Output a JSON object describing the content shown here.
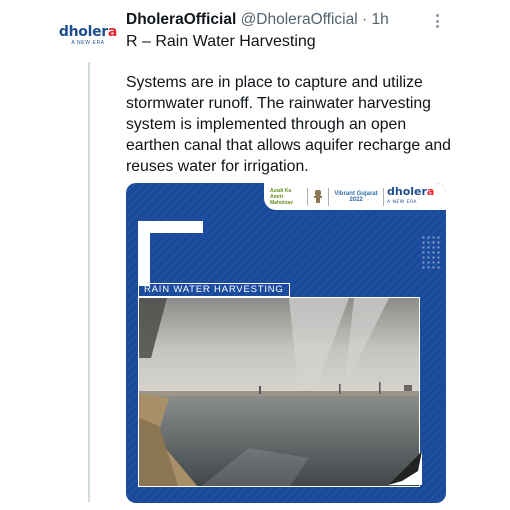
{
  "tweet": {
    "author_name": "DholeraOfficial",
    "handle": "@DholeraOfficial",
    "separator": "·",
    "time": "1h",
    "subtitle": "R – Rain Water Harvesting",
    "text": "Systems are in place to capture and utilize stormwater runoff. The rainwater harvesting system is implemented through an open earthen canal that allows aquifer recharge and reuses water for irrigation."
  },
  "avatar": {
    "brand_main": "dholer",
    "brand_dot": "a",
    "tagline": "A NEW ERA"
  },
  "card": {
    "label": "RAIN WATER HARVESTING",
    "brand_main": "dholer",
    "brand_dot": "a",
    "brand_tagline": "A NEW ERA",
    "logo_left": "Azadi Ka Amrit Mahotsav",
    "logo_middle": "Vibrant Gujarat 2022"
  },
  "colors": {
    "card_blue": "#1a4a9c",
    "brand_blue": "#1d4f91",
    "brand_red": "#e8212d",
    "muted": "#536471"
  },
  "icons": [
    "more-options-icon",
    "emblem-icon"
  ]
}
